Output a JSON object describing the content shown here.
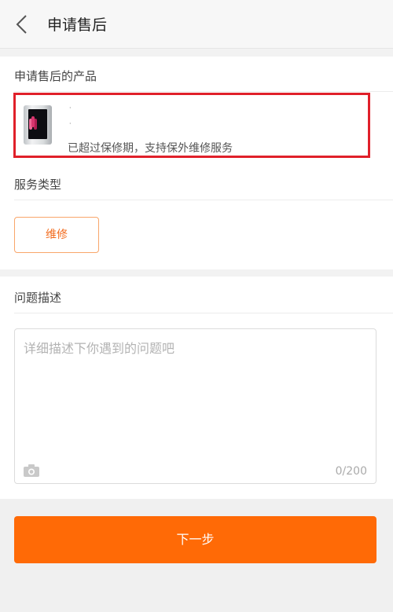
{
  "header": {
    "title": "申请售后",
    "back_icon": "chevron-left-icon"
  },
  "product_section": {
    "label": "申请售后的产品",
    "product": {
      "name_line": "·",
      "spec_line": "·",
      "note": "已超过保修期，支持保外维修服务"
    },
    "highlight_color": "#e0202a"
  },
  "service_section": {
    "label": "服务类型",
    "options": [
      {
        "label": "维修",
        "selected": true
      }
    ]
  },
  "problem_section": {
    "label": "问题描述",
    "textarea": {
      "placeholder": "详细描述下你遇到的问题吧",
      "value": "",
      "counter": "0/200"
    },
    "camera_icon": "camera-icon"
  },
  "footer": {
    "next_label": "下一步"
  },
  "colors": {
    "accent": "#ff6a06",
    "accent_text": "#f26b1d",
    "accent_border": "#f9a66a"
  }
}
